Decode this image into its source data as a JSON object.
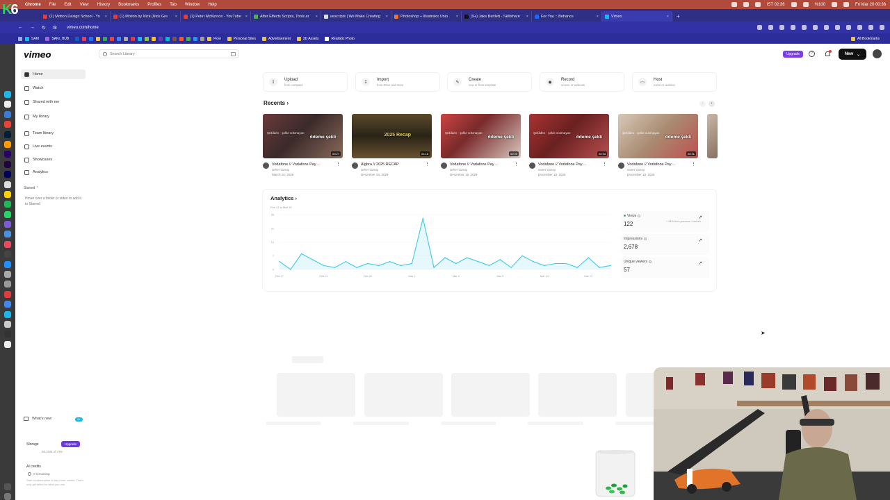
{
  "menubar": {
    "items": [
      "Chrome",
      "File",
      "Edit",
      "View",
      "History",
      "Bookmarks",
      "Profiles",
      "Tab",
      "Window",
      "Help"
    ],
    "lang": "IST 02:36",
    "battery": "%100",
    "clock": "Fri Mar 20 00:38"
  },
  "tabs": [
    {
      "title": "(1) Motion Design School - Yo"
    },
    {
      "title": "(1) Motion by Nick (Nick Gre"
    },
    {
      "title": "(1) Peter McKinnon - YouTube"
    },
    {
      "title": "After Effects Scripts, Tools ar"
    },
    {
      "title": "aescripts | We Make Creating"
    },
    {
      "title": "Photoshop + Illustrator Unio"
    },
    {
      "title": "(9+) Jake Bartlett - Skillshare"
    },
    {
      "title": "For You :: Behance"
    },
    {
      "title": "Vimeo"
    }
  ],
  "newtab": "+",
  "address": {
    "url": "vimeo.com/home"
  },
  "bookmarks": [
    "SAKI",
    "SAKI_HUB",
    "Flow",
    "Personal Sites",
    "Advertisement",
    "3D Assets",
    "Realistic Photo"
  ],
  "all_bookmarks": "All Bookmarks",
  "app": {
    "logo": "vimeo",
    "nav": [
      {
        "label": "Home"
      },
      {
        "label": "Watch"
      },
      {
        "label": "Shared with me"
      },
      {
        "label": "My library"
      },
      {
        "label": "Team library"
      },
      {
        "label": "Live events"
      },
      {
        "label": "Showcases"
      },
      {
        "label": "Analytics"
      }
    ],
    "starred": "Starred",
    "starred_hint": "Hover over a folder or video to add it to Starred",
    "whats_new": "What's new",
    "whats_new_badge": "9+",
    "storage_label": "Storage",
    "storage_upgrade": "Upgrade",
    "storage_used": "66.4GB of 4TB",
    "ai_credits": "AI credits",
    "ai_remaining": "0 remaining",
    "ai_hint": "Start a subscription to buy more credits. That's only get billed for what you use.",
    "search_placeholder": "Search Library",
    "upgrade": "Upgrade",
    "help": "?",
    "new_button": "New"
  },
  "actions": [
    {
      "title": "Upload",
      "sub": "from computer",
      "icon": "upload-icon"
    },
    {
      "title": "Import",
      "sub": "from Drive and more",
      "icon": "import-icon"
    },
    {
      "title": "Create",
      "sub": "new or from template",
      "icon": "create-icon"
    },
    {
      "title": "Record",
      "sub": "screen or webcam",
      "icon": "record-icon"
    },
    {
      "title": "Host",
      "sub": "event or webinar",
      "icon": "host-icon"
    }
  ],
  "recents": {
    "title": "Recents",
    "items": [
      {
        "title": "Vodafone // Vodafone Pay ...",
        "author": "Omer Ozsoy",
        "date": "March 10, 2026",
        "duration": "00:27",
        "overlay": "ödeme şekli"
      },
      {
        "title": "Algbra // 2025 RECAP",
        "author": "Omer Ozsoy",
        "date": "December 24, 2025",
        "duration": "01:18",
        "overlay": "2025 Recap"
      },
      {
        "title": "Vodafone // Vodafone Pay ...",
        "author": "Omer Ozsoy",
        "date": "December 19, 2025",
        "duration": "00:30",
        "overlay": "ödeme şekli"
      },
      {
        "title": "Vodafone // Vodafone Pay ...",
        "author": "Omer Ozsoy",
        "date": "December 18, 2025",
        "duration": "00:30",
        "overlay": "ödeme şekli"
      },
      {
        "title": "Vodafone // Vodafone Pay ...",
        "author": "Omer Ozsoy",
        "date": "December 18, 2025",
        "duration": "00:31",
        "overlay": "ödeme şekli"
      }
    ]
  },
  "analytics": {
    "title": "Analytics",
    "range": "Feb 17 to Mar 19",
    "stats": [
      {
        "label": "Views",
        "value": "122",
        "change": "+ 94% from previous 1 month"
      },
      {
        "label": "Impressions",
        "value": "2,678"
      },
      {
        "label": "Unique viewers",
        "value": "57"
      }
    ]
  },
  "chart_data": {
    "type": "area",
    "x": [
      "Feb 17",
      "Feb 18",
      "Feb 19",
      "Feb 20",
      "Feb 21",
      "Feb 22",
      "Feb 23",
      "Feb 24",
      "Feb 25",
      "Feb 26",
      "Feb 27",
      "Feb 28",
      "Mar 1",
      "Mar 2",
      "Mar 3",
      "Mar 4",
      "Mar 5",
      "Mar 6",
      "Mar 7",
      "Mar 8",
      "Mar 9",
      "Mar 10",
      "Mar 11",
      "Mar 12",
      "Mar 13",
      "Mar 14",
      "Mar 15",
      "Mar 16",
      "Mar 17",
      "Mar 18",
      "Mar 19"
    ],
    "series": [
      {
        "values": [
          4,
          0,
          8,
          5,
          2,
          1,
          4,
          1,
          3,
          2,
          4,
          2,
          3,
          26,
          1,
          6,
          3,
          6,
          4,
          2,
          5,
          1,
          7,
          4,
          2,
          3,
          3,
          1,
          6,
          1,
          2
        ]
      }
    ],
    "xticks": [
      "Feb 17",
      "Feb 21",
      "Feb 25",
      "Mar 1",
      "Mar 5",
      "Mar 9",
      "Mar 13",
      "Mar 17"
    ],
    "yticks": [
      0,
      7,
      14,
      21,
      28
    ],
    "ylim": [
      0,
      28
    ],
    "color": "#3cc9e8"
  }
}
